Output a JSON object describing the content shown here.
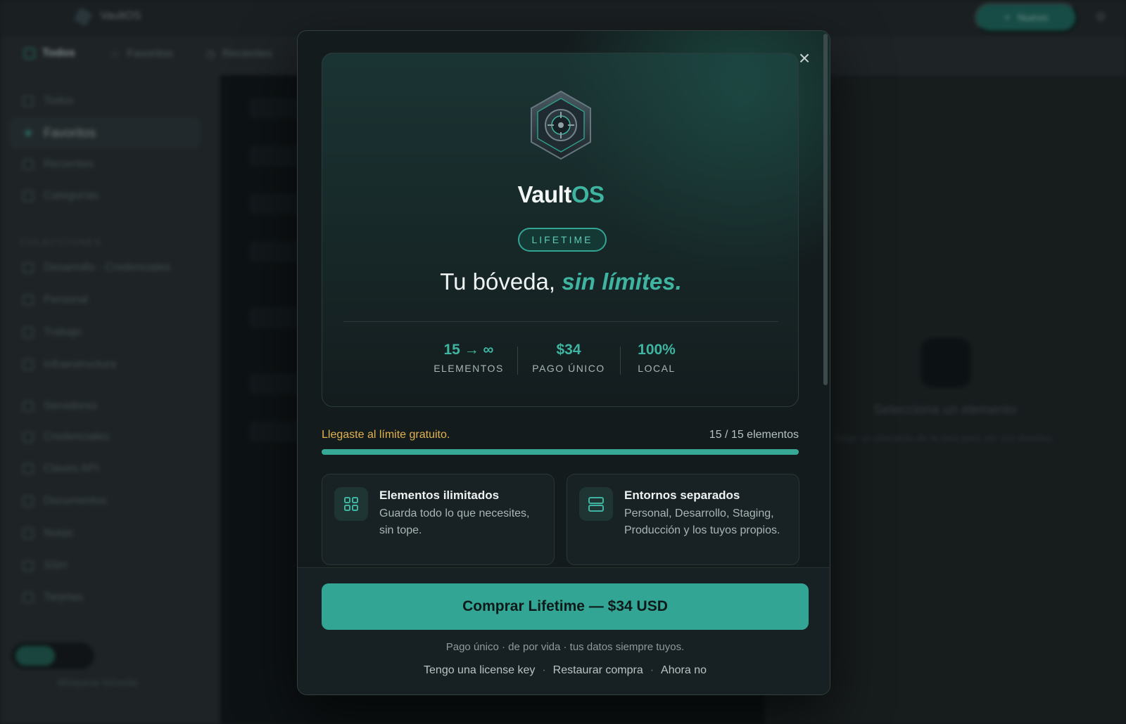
{
  "app": {
    "title": "VaultOS",
    "new_button": "Nuevo",
    "filters": [
      "Todos",
      "Favoritos",
      "Recientes"
    ],
    "sidebar": {
      "items": [
        "Todos",
        "Favoritos",
        "Recientes",
        "Categorías"
      ],
      "section": "COLECCIONES",
      "collections": [
        "Desarrollo · Credenciales",
        "Personal",
        "Trabajo",
        "Infraestructura",
        "Servidores",
        "Credenciales",
        "Claves API",
        "Documentos",
        "Notas",
        "SSH",
        "Tarjetas"
      ],
      "footer": "Bloquear bóveda"
    },
    "detail": {
      "title": "Selecciona un elemento",
      "subtitle": "Elige un elemento de la lista para ver sus detalles."
    }
  },
  "modal": {
    "brand_main": "Vault",
    "brand_accent": "OS",
    "badge": "LIFETIME",
    "headline_main": "Tu bóveda, ",
    "headline_accent": "sin límites.",
    "stats": [
      {
        "value": "15 → ∞",
        "label": "ELEMENTOS"
      },
      {
        "value": "$34",
        "label": "PAGO ÚNICO"
      },
      {
        "value": "100%",
        "label": "LOCAL"
      }
    ],
    "limit": {
      "message": "Llegaste al límite gratuito.",
      "count_text": "15 / 15 elementos",
      "used": 15,
      "max": 15
    },
    "features": [
      {
        "title": "Elementos ilimitados",
        "description": "Guarda todo lo que necesites, sin tope.",
        "icon": "grid-icon"
      },
      {
        "title": "Entornos separados",
        "description": "Personal, Desarrollo, Staging, Producción y los tuyos propios.",
        "icon": "server-icon"
      }
    ],
    "cta": "Comprar Lifetime — $34 USD",
    "note": "Pago único · de por vida · tus datos siempre tuyos.",
    "links": [
      "Tengo una license key",
      "Restaurar compra",
      "Ahora no"
    ],
    "colors": {
      "accent": "#3fb5a1",
      "warning": "#e2b24f",
      "button": "#33a594"
    }
  }
}
